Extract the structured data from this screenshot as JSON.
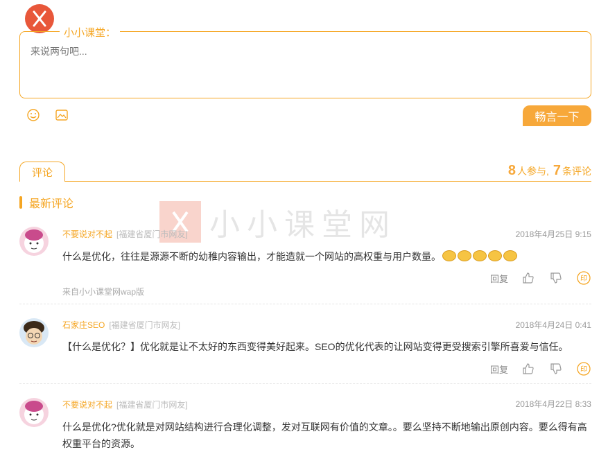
{
  "compose": {
    "label": "小小课堂：",
    "placeholder": "来说两句吧...",
    "post_button": "畅言一下",
    "icons": [
      "smile-icon",
      "image-icon"
    ]
  },
  "tabs": {
    "comments_tab": "评论"
  },
  "stats": {
    "participants": "8",
    "participants_label": "人参与,",
    "comments": "7",
    "comments_label": "条评论"
  },
  "section_title": "最新评论",
  "watermark": "小小课堂网",
  "comments": [
    {
      "user": "不要说对不起",
      "location": "[福建省厦门市网友]",
      "time": "2018年4月25日 9:15",
      "text": "什么是优化，往往是源源不断的幼稚内容输出，才能造就一个网站的高权重与用户数量。",
      "emoji_count": 5,
      "reply": "回复",
      "source": "来自小小课堂网wap版"
    },
    {
      "user": "石家庄SEO",
      "location": "[福建省厦门市网友]",
      "time": "2018年4月24日 0:41",
      "text": "【什么是优化？】优化就是让不太好的东西变得美好起来。SEO的优化代表的让网站变得更受搜索引擎所喜爱与信任。",
      "reply": "回复"
    },
    {
      "user": "不要说对不起",
      "location": "[福建省厦门市网友]",
      "time": "2018年4月22日 8:33",
      "text": "什么是优化?优化就是对网站结构进行合理化调整，发对互联网有价值的文章。。要么坚持不断地输出原创内容。要么得有高权重平台的资源。"
    }
  ],
  "colors": {
    "accent": "#f5a623",
    "button": "#f7a83a",
    "logo": "#e8573a"
  }
}
